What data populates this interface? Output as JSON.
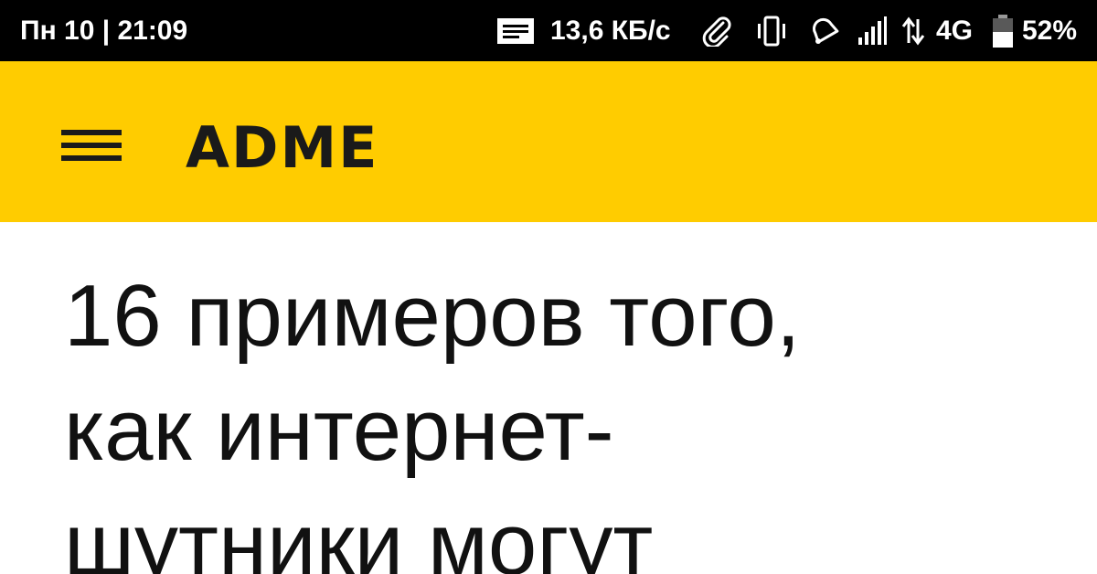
{
  "status_bar": {
    "datetime": "Пн 10 | 21:09",
    "net_speed": "13,6 КБ/с",
    "network_type": "4G",
    "battery": "52%",
    "icons": [
      "message-icon",
      "paperclip-icon",
      "vibrate-icon",
      "alarm-bell-icon",
      "signal-icon",
      "data-arrows-icon",
      "battery-icon"
    ],
    "battery_level": 0.52
  },
  "app_bar": {
    "logo": "ADME",
    "menu_icon": "hamburger-menu-icon",
    "background": "#ffcc00",
    "logo_color": "#1a1a1a"
  },
  "article": {
    "headline_lines": [
      "16 примеров того,",
      "как интернет-",
      "шутники могут"
    ]
  }
}
